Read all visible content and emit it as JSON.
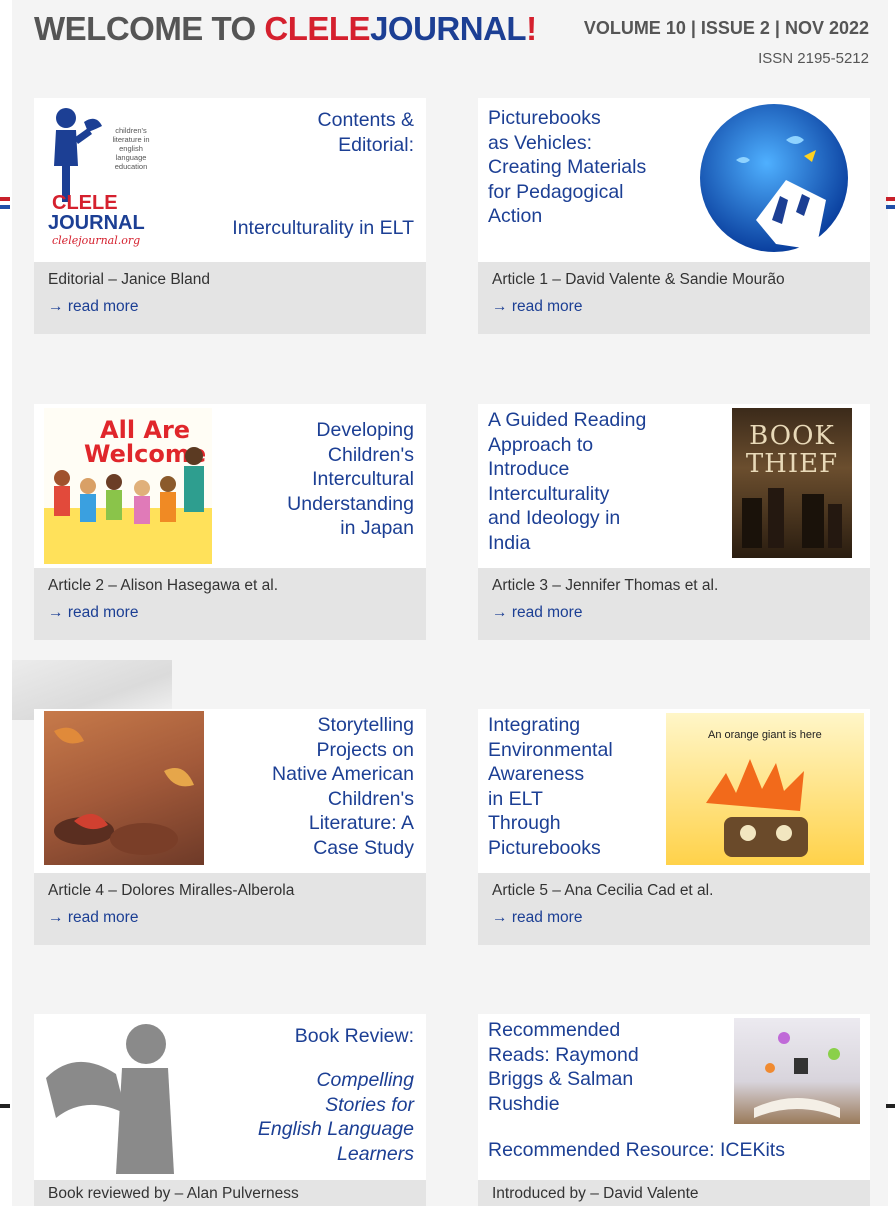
{
  "header": {
    "welcome": "WELCOME TO ",
    "brand_part1": "CLELE",
    "brand_part2": "JOURNAL",
    "brand_part3": "!",
    "volume": "VOLUME 10 | ISSUE 2 | NOV 2022",
    "issn": "ISSN 2195-5212"
  },
  "read_more": "read more",
  "cards": [
    {
      "title_lines": [
        "Contents &",
        "Editorial:"
      ],
      "subtitle": "Interculturality in ELT",
      "logo_lines": [
        "children's",
        "literature in",
        "english",
        "language",
        "education"
      ],
      "logo_brand": "CLELE",
      "logo_journal": "JOURNAL",
      "logo_url": "clelejournal.org",
      "byline": "Editorial – Janice Bland"
    },
    {
      "title_lines": [
        "Picturebooks",
        "as Vehicles:",
        "Creating Materials",
        "for Pedagogical",
        "Action"
      ],
      "byline": "Article 1 – David Valente & Sandie Mourão"
    },
    {
      "title_lines": [
        "Developing",
        "Children's",
        "Intercultural",
        "Understanding",
        "in Japan"
      ],
      "cover_line1": "All Are",
      "cover_line2": "Welcome",
      "byline": "Article 2 – Alison Hasegawa et al."
    },
    {
      "title_lines": [
        "A Guided Reading",
        "Approach to",
        "Introduce",
        "Interculturality",
        "and Ideology in",
        "India"
      ],
      "cover_line1": "BOOK",
      "cover_line2": "THIEF",
      "byline": "Article 3 – Jennifer Thomas et al."
    },
    {
      "title_lines": [
        "Storytelling",
        "Projects on",
        "Native American",
        "Children's",
        "Literature: A",
        "Case Study"
      ],
      "byline": "Article 4 – Dolores Miralles-Alberola"
    },
    {
      "title_lines": [
        "Integrating",
        "Environmental",
        "Awareness",
        "in ELT",
        "Through",
        "Picturebooks"
      ],
      "cover_text": "An orange giant is here",
      "byline": "Article 5 – Ana Cecilia Cad et al."
    },
    {
      "title_lines": [
        "Book Review:"
      ],
      "subtitle_lines": [
        "Compelling",
        "Stories for",
        "English Language",
        "Learners"
      ],
      "byline": "Book reviewed by – Alan Pulverness"
    },
    {
      "title_lines": [
        "Recommended",
        "Reads: Raymond",
        "Briggs & Salman",
        "Rushdie"
      ],
      "subtitle": "Recommended Resource: ICEKits",
      "byline": "Introduced by – David Valente"
    }
  ],
  "colors": {
    "brand_red": "#d5202e",
    "brand_blue": "#1c3f94",
    "text_grey": "#555555",
    "footer_grey": "#e4e4e4"
  }
}
